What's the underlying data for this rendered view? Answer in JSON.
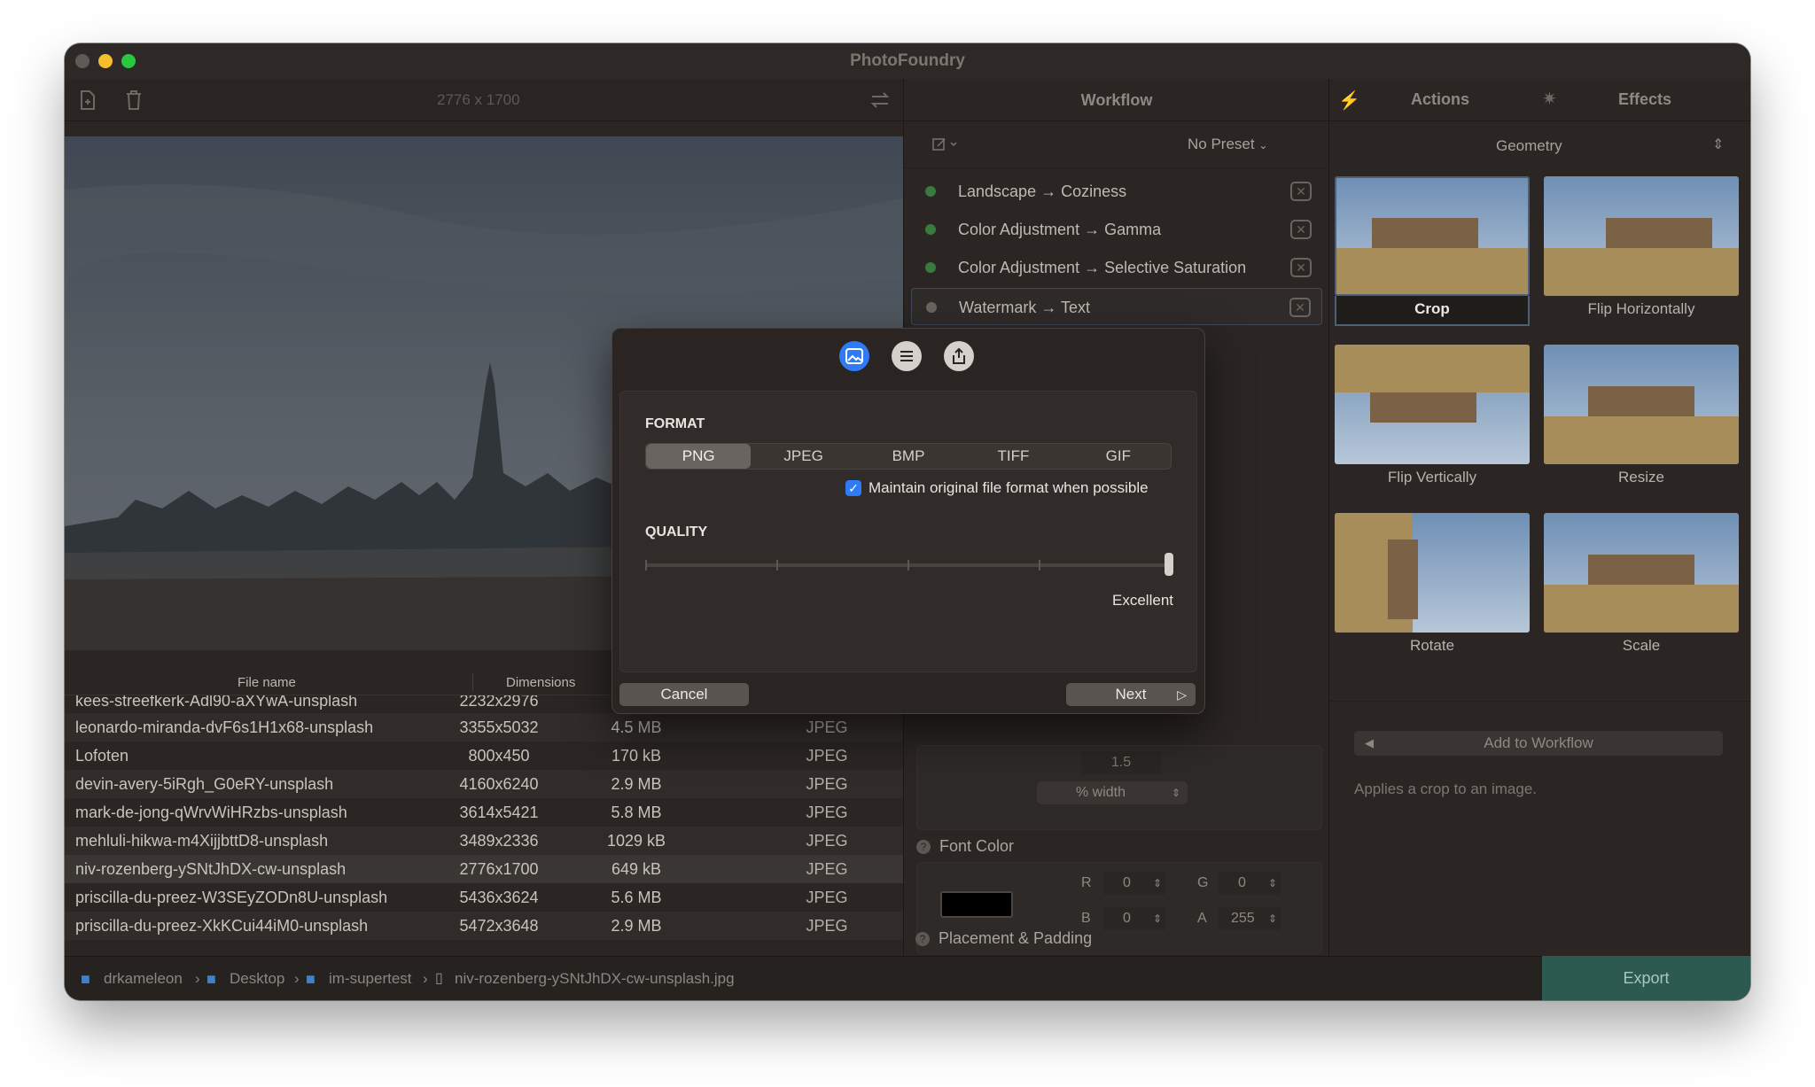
{
  "app": {
    "title": "PhotoFoundry"
  },
  "toolbar": {
    "dimensions": "2776 x 1700"
  },
  "workflow": {
    "title": "Workflow",
    "preset": "No Preset",
    "items": [
      {
        "label": "Landscape → Coziness",
        "active": true
      },
      {
        "label": "Color Adjustment → Gamma",
        "active": true
      },
      {
        "label": "Color Adjustment → Selective Saturation",
        "active": true
      },
      {
        "label": "Watermark → Text",
        "active": false
      }
    ],
    "line_height_value": "1.5",
    "size_unit": "% width",
    "font_color_label": "Font Color",
    "rgba": {
      "r_label": "R",
      "r": "0",
      "g_label": "G",
      "g": "0",
      "b_label": "B",
      "b": "0",
      "a_label": "A",
      "a": "255"
    },
    "placement_label": "Placement & Padding"
  },
  "actions": {
    "tab_actions": "Actions",
    "tab_effects": "Effects",
    "category": "Geometry",
    "items": [
      {
        "label": "Crop",
        "selected": true
      },
      {
        "label": "Flip Horizontally",
        "selected": false
      },
      {
        "label": "Flip Vertically",
        "selected": false
      },
      {
        "label": "Resize",
        "selected": false
      },
      {
        "label": "Rotate",
        "selected": false
      },
      {
        "label": "Scale",
        "selected": false
      }
    ],
    "add_to_workflow": "Add to Workflow",
    "description": "Applies a crop to an image."
  },
  "files": {
    "headers": {
      "name": "File name",
      "dimensions": "Dimensions"
    },
    "rows": [
      {
        "name": "kees-streefkerk-Adl90-aXYwA-unsplash",
        "dimensions": "2232x2976",
        "size": "",
        "type": ""
      },
      {
        "name": "leonardo-miranda-dvF6s1H1x68-unsplash",
        "dimensions": "3355x5032",
        "size": "4.5 MB",
        "type": "JPEG"
      },
      {
        "name": "Lofoten",
        "dimensions": "800x450",
        "size": "170 kB",
        "type": "JPEG"
      },
      {
        "name": "devin-avery-5iRgh_G0eRY-unsplash",
        "dimensions": "4160x6240",
        "size": "2.9 MB",
        "type": "JPEG"
      },
      {
        "name": "mark-de-jong-qWrvWiHRzbs-unsplash",
        "dimensions": "3614x5421",
        "size": "5.8 MB",
        "type": "JPEG"
      },
      {
        "name": "mehluli-hikwa-m4XijjbttD8-unsplash",
        "dimensions": "3489x2336",
        "size": "1029 kB",
        "type": "JPEG"
      },
      {
        "name": "niv-rozenberg-ySNtJhDX-cw-unsplash",
        "dimensions": "2776x1700",
        "size": "649 kB",
        "type": "JPEG"
      },
      {
        "name": "priscilla-du-preez-W3SEyZODn8U-unsplash",
        "dimensions": "5436x3624",
        "size": "5.6 MB",
        "type": "JPEG"
      },
      {
        "name": "priscilla-du-preez-XkKCui44iM0-unsplash",
        "dimensions": "5472x3648",
        "size": "2.9 MB",
        "type": "JPEG"
      }
    ]
  },
  "path": {
    "segments": [
      "drkameleon",
      "Desktop",
      "im-supertest"
    ],
    "file": "niv-rozenberg-ySNtJhDX-cw-unsplash.jpg"
  },
  "export_label": "Export",
  "modal": {
    "format_label": "FORMAT",
    "formats": [
      "PNG",
      "JPEG",
      "BMP",
      "TIFF",
      "GIF"
    ],
    "selected_format": "PNG",
    "maintain_checkbox": "Maintain original file format when possible",
    "maintain_checked": true,
    "quality_label": "QUALITY",
    "quality_value_label": "Excellent",
    "quality_fraction": 1.0,
    "cancel": "Cancel",
    "next": "Next"
  },
  "colors": {
    "accent": "#2f7bf5",
    "export_bg": "#2c5a50",
    "active_dot": "#3a7a3f"
  }
}
